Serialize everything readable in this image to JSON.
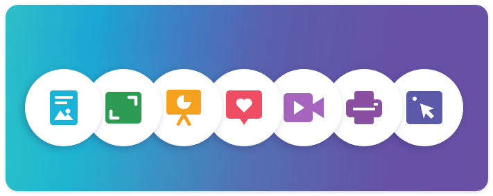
{
  "banner": {
    "colors": {
      "gradient_start": "#2cc0c8",
      "gradient_end": "#6a4fa3"
    }
  },
  "icons": [
    {
      "name": "image-document-icon",
      "color": "#1ab2d6"
    },
    {
      "name": "fullscreen-icon",
      "color": "#2e9b52"
    },
    {
      "name": "presentation-chart-icon",
      "color": "#f6a21e"
    },
    {
      "name": "heart-message-icon",
      "color": "#ef4d63"
    },
    {
      "name": "video-camera-icon",
      "color": "#a565bf"
    },
    {
      "name": "printer-icon",
      "color": "#8a4fa0"
    },
    {
      "name": "cursor-window-icon",
      "color": "#5a5aa8"
    }
  ]
}
